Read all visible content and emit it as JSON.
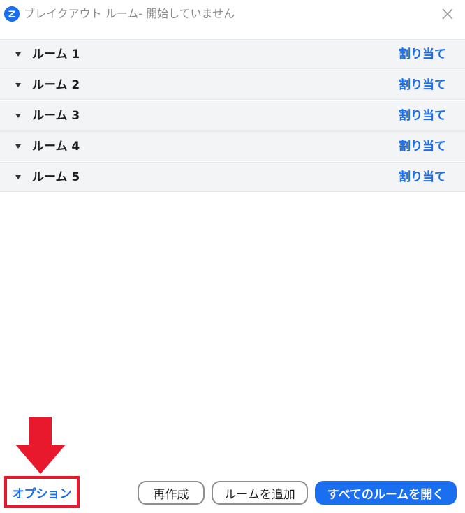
{
  "window": {
    "title": "ブレイクアウト ルーム- 開始していません"
  },
  "rooms": [
    {
      "name": "ルーム 1",
      "assign_label": "割り当て"
    },
    {
      "name": "ルーム 2",
      "assign_label": "割り当て"
    },
    {
      "name": "ルーム 3",
      "assign_label": "割り当て"
    },
    {
      "name": "ルーム 4",
      "assign_label": "割り当て"
    },
    {
      "name": "ルーム 5",
      "assign_label": "割り当て"
    }
  ],
  "footer": {
    "options_label": "オプション",
    "recreate_label": "再作成",
    "add_room_label": "ルームを追加",
    "open_all_label": "すべてのルームを開く"
  },
  "colors": {
    "accent": "#1a6ef0",
    "annotation": "#e8192c",
    "row_background": "#f3f4f6"
  },
  "icons": {
    "app": "zoom-logo-icon",
    "close": "close-icon",
    "expand": "caret-down-icon",
    "annotation": "red-down-arrow"
  }
}
